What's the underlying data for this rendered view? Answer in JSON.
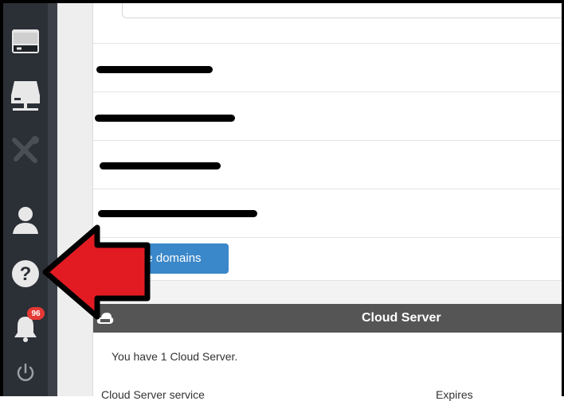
{
  "sidebar": {
    "items": [
      {
        "icon": "server-icon",
        "label": ""
      },
      {
        "icon": "network-server-icon",
        "label": ""
      },
      {
        "icon": "tools-icon",
        "label": ""
      },
      {
        "icon": "user-icon",
        "label": ""
      },
      {
        "icon": "help-icon",
        "label": ""
      },
      {
        "icon": "bell-icon",
        "label": ""
      },
      {
        "icon": "power-icon",
        "label": ""
      }
    ],
    "notification_count": "96"
  },
  "domains": {
    "manage_label": "ge domains"
  },
  "panel": {
    "title": "Cloud Server",
    "summary": "You have 1 Cloud Server.",
    "col1": "Cloud Server service",
    "col2": "Expires"
  },
  "colors": {
    "sidebar": "#2b2f36",
    "accent": "#3a87c9",
    "panel_header": "#555555",
    "arrow": "#e21b23",
    "badge": "#e53935"
  }
}
